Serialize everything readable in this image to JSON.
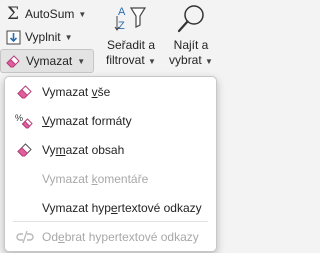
{
  "ribbon": {
    "autosum_label": "AutoSum",
    "fill_label": "Vyplnit",
    "clear_label": "Vymazat",
    "sort_filter": {
      "line1": "Seřadit a",
      "line2": "filtrovat"
    },
    "find_select": {
      "line1": "Najít a",
      "line2": "vybrat"
    }
  },
  "menu": {
    "items": [
      {
        "pre": "Vymazat ",
        "key": "v",
        "post": "še"
      },
      {
        "pre": "",
        "key": "V",
        "post": "ymazat formáty"
      },
      {
        "pre": "Vy",
        "key": "m",
        "post": "azat obsah"
      },
      {
        "pre": "Vymazat ",
        "key": "k",
        "post": "omentáře"
      },
      {
        "pre": "Vymazat hyp",
        "key": "e",
        "post": "rtextové odkazy"
      },
      {
        "pre": "Od",
        "key": "e",
        "post": "brat hypertextové odkazy"
      }
    ]
  },
  "colors": {
    "eraser_pink": "#e0609c",
    "accent_blue": "#2b6cb0",
    "menu_bg": "#ffffff",
    "ribbon_bg": "#f3f3f3"
  }
}
